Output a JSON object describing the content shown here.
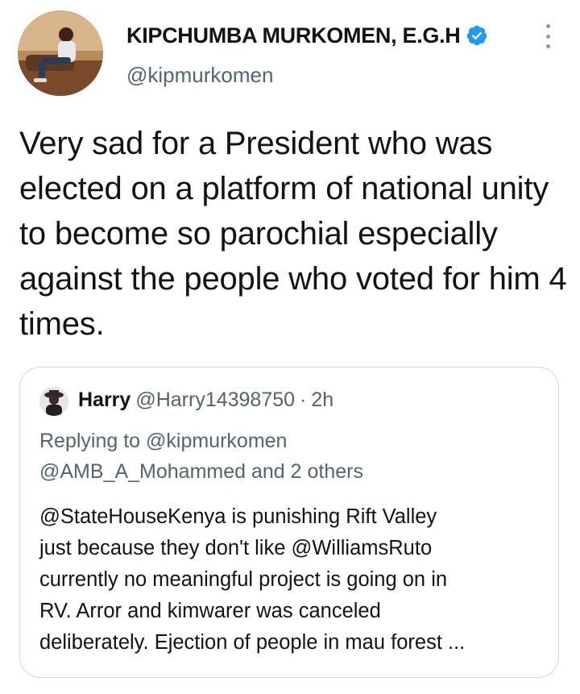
{
  "author": {
    "display_name": "KIPCHUMBA MURKOMEN, E.G.H",
    "handle": "@kipmurkomen",
    "verified": true,
    "verified_color": "#1d9bf0",
    "avatar_icon": "profile-photo"
  },
  "more_icon": "vertical-ellipsis-icon",
  "tweet": {
    "text": "Very sad for a President who was elected on a platform of national unity to become so parochial especially against the people who voted for him 4 times."
  },
  "quoted": {
    "name": "Harry",
    "handle": "@Harry14398750",
    "separator": "·",
    "time": "2h",
    "replying_lines": [
      "Replying to @kipmurkomen",
      "@AMB_A_Mohammed and 2 others"
    ],
    "text_lines": [
      "@StateHouseKenya is punishing Rift Valley",
      "just because they don't like  @WilliamsRuto",
      "currently no meaningful project is going on in",
      "RV. Arror and kimwarer was canceled",
      "deliberately. Ejection of people in mau forest ..."
    ]
  },
  "colors": {
    "text_primary": "#0f1419",
    "text_secondary": "#536471",
    "border": "#cfd9de"
  }
}
